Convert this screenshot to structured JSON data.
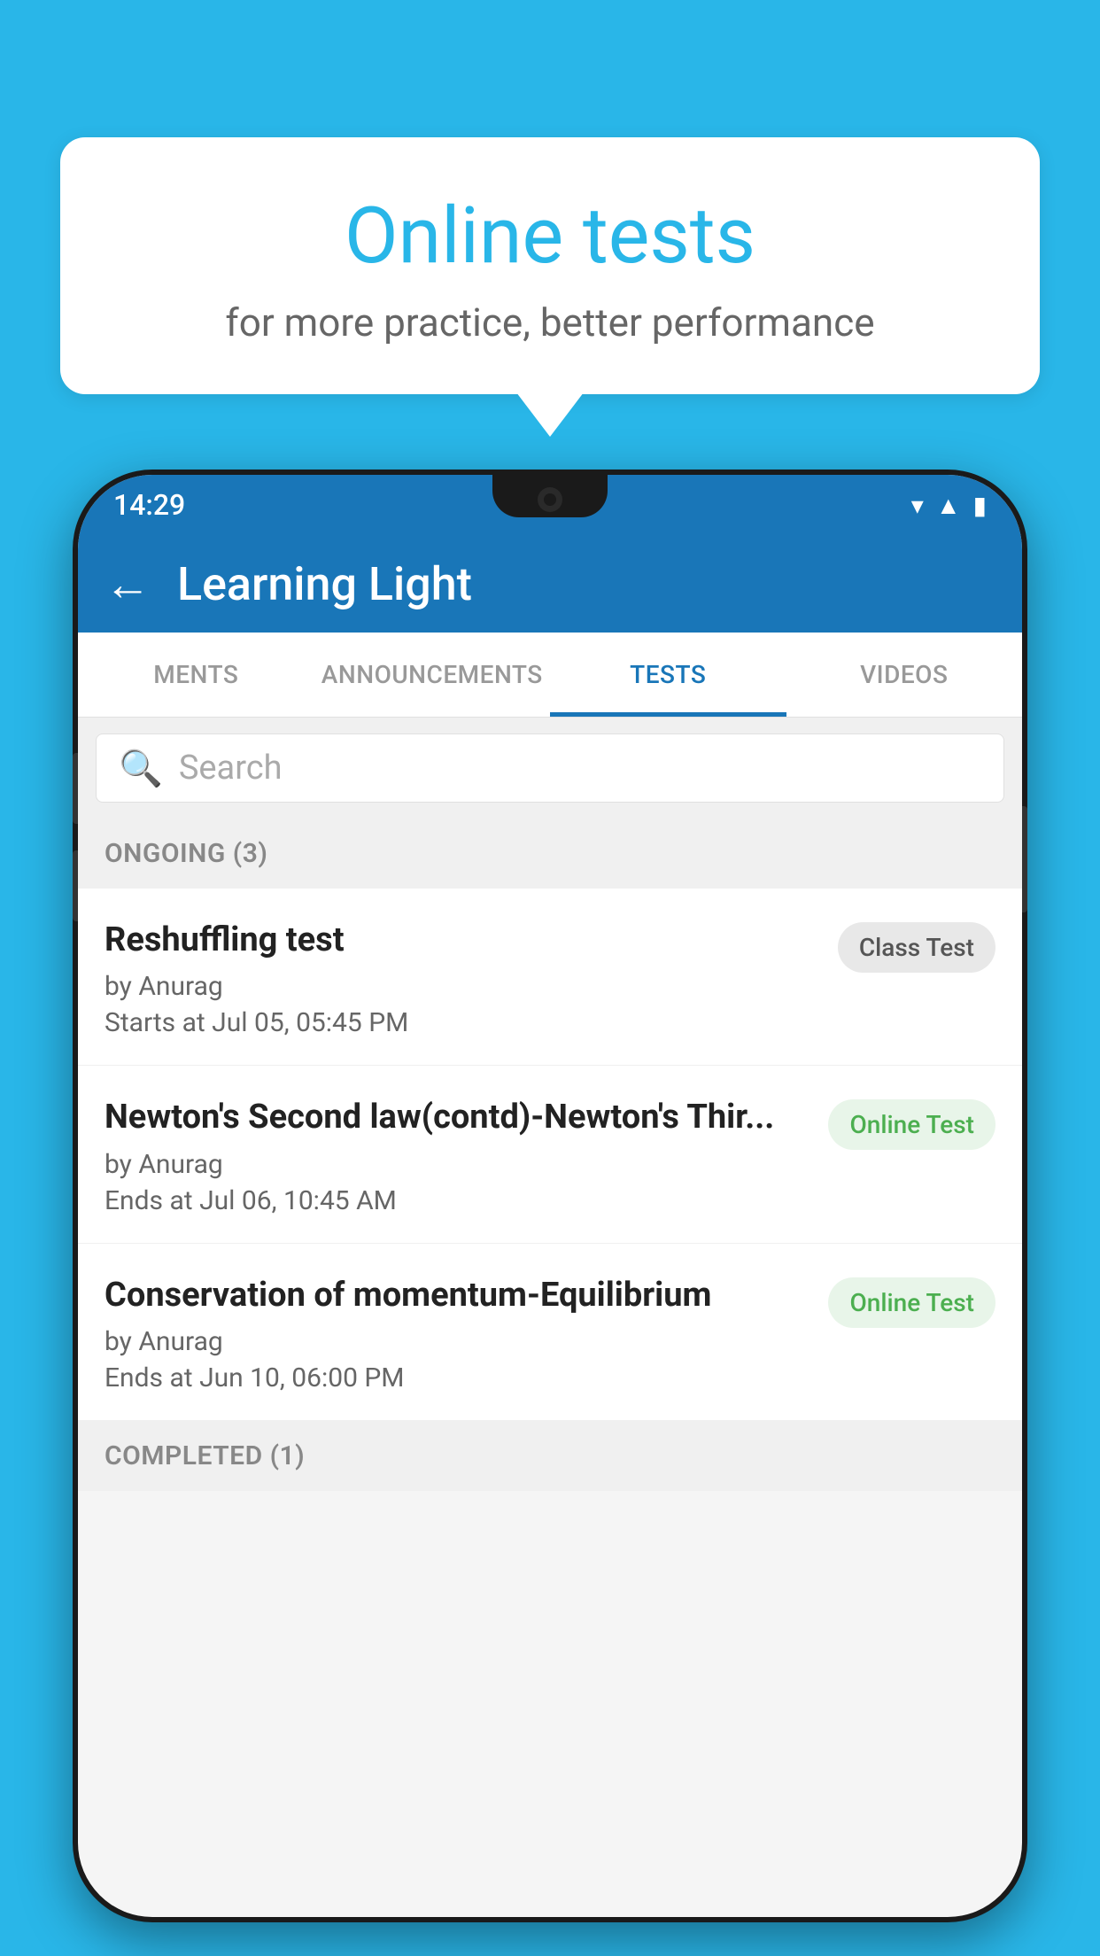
{
  "background_color": "#29b6e8",
  "bubble": {
    "title": "Online tests",
    "subtitle": "for more practice, better performance"
  },
  "status_bar": {
    "time": "14:29",
    "icons": [
      "wifi",
      "signal",
      "battery"
    ]
  },
  "app_bar": {
    "back_label": "←",
    "title": "Learning Light"
  },
  "tabs": [
    {
      "label": "MENTS",
      "active": false
    },
    {
      "label": "ANNOUNCEMENTS",
      "active": false
    },
    {
      "label": "TESTS",
      "active": true
    },
    {
      "label": "VIDEOS",
      "active": false
    }
  ],
  "search": {
    "placeholder": "Search",
    "icon": "🔍"
  },
  "ongoing_section": {
    "label": "ONGOING (3)"
  },
  "tests": [
    {
      "title": "Reshuffling test",
      "author": "by Anurag",
      "time_label": "Starts at",
      "time": "Jul 05, 05:45 PM",
      "badge": "Class Test",
      "badge_type": "class"
    },
    {
      "title": "Newton's Second law(contd)-Newton's Thir...",
      "author": "by Anurag",
      "time_label": "Ends at",
      "time": "Jul 06, 10:45 AM",
      "badge": "Online Test",
      "badge_type": "online"
    },
    {
      "title": "Conservation of momentum-Equilibrium",
      "author": "by Anurag",
      "time_label": "Ends at",
      "time": "Jun 10, 06:00 PM",
      "badge": "Online Test",
      "badge_type": "online"
    }
  ],
  "completed_section": {
    "label": "COMPLETED (1)"
  }
}
